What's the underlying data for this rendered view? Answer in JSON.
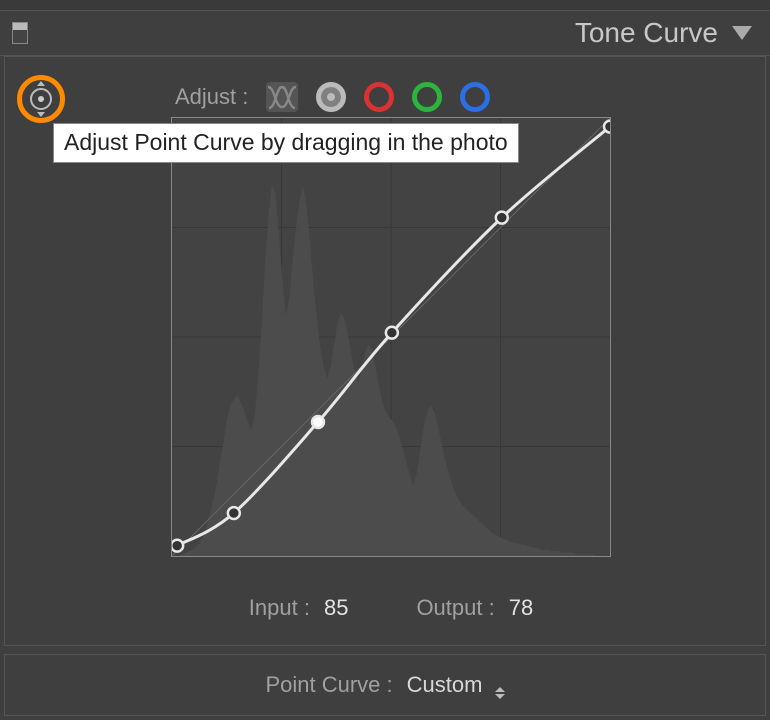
{
  "panel": {
    "title": "Tone Curve"
  },
  "adjust": {
    "label": "Adjust :",
    "tooltip": "Adjust Point Curve by dragging in the photo",
    "channels": [
      "rgb",
      "red",
      "green",
      "blue"
    ],
    "active_channel": "rgb"
  },
  "chart_data": {
    "type": "line",
    "title": "Tone Curve",
    "xlabel": "Input",
    "ylabel": "Output",
    "xlim": [
      0,
      255
    ],
    "ylim": [
      0,
      255
    ],
    "diagonal": [
      [
        0,
        0
      ],
      [
        255,
        255
      ]
    ],
    "points": [
      {
        "input": 3,
        "output": 6
      },
      {
        "input": 36,
        "output": 25
      },
      {
        "input": 85,
        "output": 78,
        "selected": true
      },
      {
        "input": 128,
        "output": 130
      },
      {
        "input": 192,
        "output": 197
      },
      {
        "input": 255,
        "output": 250
      }
    ],
    "histogram": [
      0,
      0,
      0,
      1,
      2,
      3,
      4,
      6,
      8,
      12,
      18,
      26,
      35,
      46,
      60,
      72,
      86,
      94,
      98,
      100,
      96,
      90,
      84,
      78,
      88,
      112,
      145,
      182,
      214,
      232,
      226,
      200,
      172,
      150,
      160,
      185,
      205,
      222,
      230,
      218,
      196,
      170,
      148,
      130,
      118,
      110,
      118,
      132,
      145,
      152,
      148,
      138,
      126,
      114,
      108,
      116,
      126,
      132,
      128,
      118,
      106,
      96,
      90,
      86,
      84,
      80,
      74,
      66,
      58,
      50,
      44,
      52,
      66,
      80,
      90,
      94,
      90,
      82,
      72,
      62,
      54,
      46,
      40,
      36,
      32,
      30,
      28,
      26,
      24,
      22,
      20,
      18,
      16,
      14,
      13,
      12,
      11,
      10,
      9,
      8,
      8,
      7,
      7,
      6,
      6,
      5,
      5,
      4,
      4,
      4,
      3,
      3,
      3,
      2,
      2,
      2,
      2,
      1,
      1,
      1,
      1,
      1,
      1,
      0,
      0,
      0,
      0,
      0
    ]
  },
  "readout": {
    "input_label": "Input :",
    "input_value": "85",
    "output_label": "Output :",
    "output_value": "78"
  },
  "footer": {
    "label": "Point Curve :",
    "value": "Custom"
  }
}
